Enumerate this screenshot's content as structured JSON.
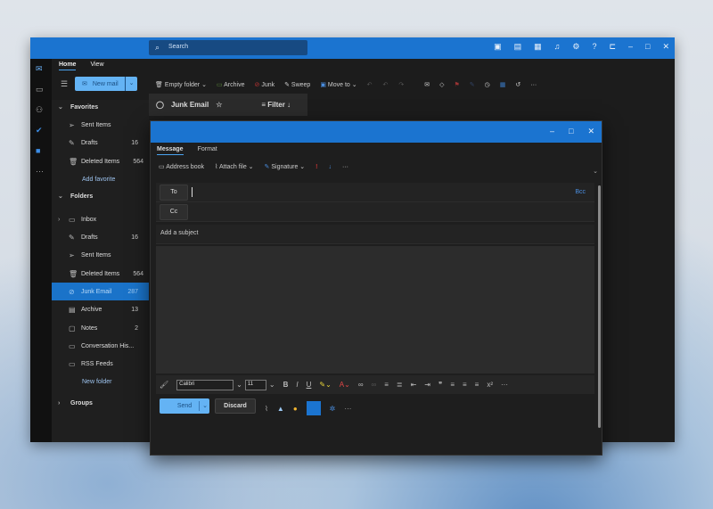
{
  "titlebar": {
    "search_placeholder": "Search",
    "icons": [
      "meet-now-icon",
      "teams-icon",
      "calendar-sync-icon",
      "bell-icon",
      "gear-icon",
      "help-icon",
      "feedback-icon"
    ],
    "window_controls": [
      "minimize",
      "maximize",
      "close"
    ]
  },
  "ribbon": {
    "tabs": [
      "Home",
      "View"
    ],
    "new_mail": "New mail",
    "actions": [
      "Empty folder",
      "Archive",
      "Junk",
      "Sweep",
      "Move to"
    ]
  },
  "folders": {
    "favorites_header": "Favorites",
    "favorites": [
      {
        "label": "Sent Items",
        "icon": "send-icon",
        "count": ""
      },
      {
        "label": "Drafts",
        "icon": "pencil-icon",
        "count": "16"
      },
      {
        "label": "Deleted Items",
        "icon": "trash-icon",
        "count": "564"
      }
    ],
    "add_favorite": "Add favorite",
    "folders_header": "Folders",
    "items": [
      {
        "label": "Inbox",
        "icon": "inbox-icon",
        "count": ""
      },
      {
        "label": "Drafts",
        "icon": "pencil-icon",
        "count": "16"
      },
      {
        "label": "Sent Items",
        "icon": "send-icon",
        "count": ""
      },
      {
        "label": "Deleted Items",
        "icon": "trash-icon",
        "count": "564"
      },
      {
        "label": "Junk Email",
        "icon": "junk-icon",
        "count": "287"
      },
      {
        "label": "Archive",
        "icon": "archive-icon",
        "count": "13"
      },
      {
        "label": "Notes",
        "icon": "note-icon",
        "count": "2"
      },
      {
        "label": "Conversation His...",
        "icon": "folder-icon",
        "count": ""
      },
      {
        "label": "RSS Feeds",
        "icon": "folder-icon",
        "count": ""
      }
    ],
    "new_folder": "New folder",
    "groups_header": "Groups"
  },
  "message_list": {
    "folder_title": "Junk Email",
    "filter": "Filter"
  },
  "compose": {
    "tabs": [
      "Message",
      "Format"
    ],
    "toolbar": [
      "Address book",
      "Attach file",
      "Signature"
    ],
    "to_label": "To",
    "cc_label": "Cc",
    "bcc_label": "Bcc",
    "subject_placeholder": "Add a subject",
    "font_name": "Calibri",
    "font_size": "11",
    "send": "Send",
    "discard": "Discard"
  },
  "colors": {
    "accent": "#1b74d0",
    "selected": "#1a73c9",
    "primary_button": "#64b3f4"
  }
}
